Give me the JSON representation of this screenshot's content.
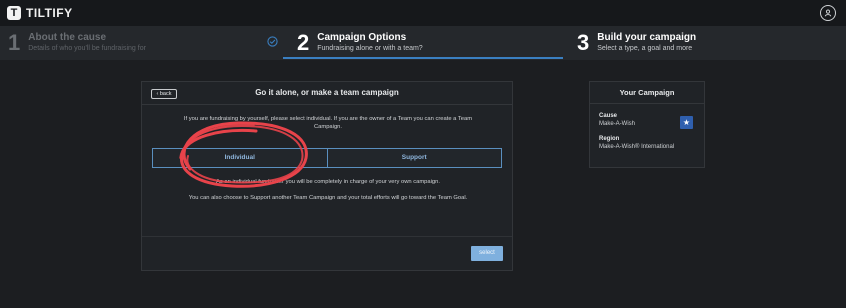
{
  "brand": {
    "name": "TILTIFY",
    "logo_glyph": "T"
  },
  "header": {
    "user_icon": "user-circle-icon"
  },
  "steps": [
    {
      "number": "1",
      "title": "About the cause",
      "subtitle": "Details of who you'll be fundraising for",
      "state": "completed"
    },
    {
      "number": "2",
      "title": "Campaign Options",
      "subtitle": "Fundraising alone or with a team?",
      "state": "active"
    },
    {
      "number": "3",
      "title": "Build your campaign",
      "subtitle": "Select a type, a goal and more",
      "state": "upcoming"
    }
  ],
  "card": {
    "back_label": "‹ back",
    "title": "Go it alone, or make a team campaign",
    "intro": "If you are fundraising by yourself, please select individual. If you are the owner of a Team you can create a Team Campaign.",
    "options": [
      "Individual",
      "Support"
    ],
    "description_1": "As an individual fundraiser you will be completely in charge of your very own campaign.",
    "description_2": "You can also choose to Support another Team Campaign and your total efforts will go toward the Team Goal.",
    "select_label": "select"
  },
  "sidebar": {
    "title": "Your Campaign",
    "cause_label": "Cause",
    "cause_value": "Make-A-Wish",
    "region_label": "Region",
    "region_value": "Make-A-Wish® International"
  },
  "colors": {
    "accent": "#3a7fc1",
    "select_button": "#7fb0de",
    "annotation_circle": "#e8434a",
    "background": "#1c1e21"
  }
}
